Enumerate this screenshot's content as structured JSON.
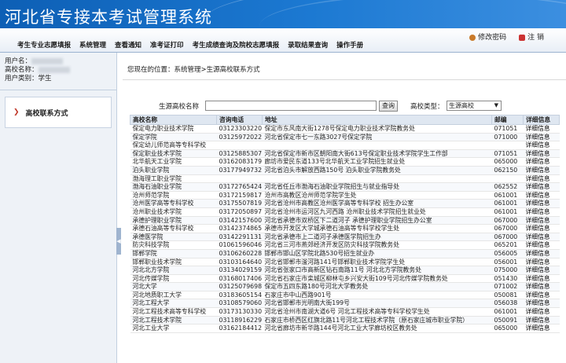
{
  "app": {
    "title": "河北省专接本考试管理系统"
  },
  "header": {
    "change_password": "修改密码",
    "logout": "注 销"
  },
  "menu": [
    "考生专业志愿填报",
    "系统管理",
    "查看通知",
    "准考证打印",
    "考生成绩查询及院校志愿填报",
    "录取结果查询",
    "操作手册"
  ],
  "sidebar": {
    "username_label": "用户名：",
    "school_label": "高校名称：",
    "usertype_label": "用户类别：",
    "usertype_value": "学生",
    "nav_item": "高校联系方式"
  },
  "breadcrumb": "您现在的位置：系统管理>生源高校联系方式",
  "filter": {
    "name_label": "生源高校名称",
    "name_value": "",
    "query_button": "查询",
    "type_label": "高校类型：",
    "type_value": "生源高校"
  },
  "table": {
    "headers": [
      "高校名称",
      "咨询电话",
      "地址",
      "邮编",
      "详细信息"
    ],
    "rows": [
      [
        "保定电力职业技术学院",
        "03123303220",
        "保定市东风南大街1278号保定电力职业技术学院教务处",
        "071051",
        "详细信息"
      ],
      [
        "保定学院",
        "03125972022",
        "河北省保定市七一东路3027号保定学院",
        "071000",
        "详细信息"
      ],
      [
        "保定幼儿师范高等专科学校",
        "",
        "",
        "",
        "详细信息"
      ],
      [
        "保定职业技术学院",
        "03125885307",
        "河北省保定市新市区朝阳南大街613号保定职业技术学院学生工作部",
        "071051",
        "详细信息"
      ],
      [
        "北华航天工业学院",
        "03162083179",
        "廊坊市爱民东道133号北华航天工业学院招生就业处",
        "065000",
        "详细信息"
      ],
      [
        "泊头职业学院",
        "03177949732",
        "河北省泊头市解放西路150号 泊头职业学院教务处",
        "062150",
        "详细信息"
      ],
      [
        "渤海理工职业学院",
        "",
        "",
        "",
        "详细信息"
      ],
      [
        "渤海石油职业学院",
        "03172765424",
        "河北省任丘市渤海石油职业学院招生与就业指导处",
        "062552",
        "详细信息"
      ],
      [
        "沧州师范学院",
        "03172159817",
        "沧州市高教区沧州师范学院学生处",
        "061001",
        "详细信息"
      ],
      [
        "沧州医学高等专科学校",
        "03175507819",
        "河北省沧州市高教区沧州医学高等专科学校 招生办公室",
        "061001",
        "详细信息"
      ],
      [
        "沧州职业技术学院",
        "03172050897",
        "河北省沧州市运河区九河西路 沧州职业技术学院招生就业处",
        "061001",
        "详细信息"
      ],
      [
        "承德护理职业学院",
        "03142157600",
        "河北省承德市双桥区下二道河子 承德护理职业学院招生办公室",
        "067000",
        "详细信息"
      ],
      [
        "承德石油高等专科学校",
        "03142374865",
        "承德市开发区大学城承德石油高等专科学校学生处",
        "067000",
        "详细信息"
      ],
      [
        "承德医学院",
        "03142291131",
        "河北省承德市上二道河子承德医学院招生办",
        "067000",
        "详细信息"
      ],
      [
        "防灾科技学院",
        "01061596046",
        "河北省三河市燕郊经济开发区防灾科技学院教务处",
        "065201",
        "详细信息"
      ],
      [
        "邯郸学院",
        "03106260228",
        "邯郸市邯山区学院北路530号招生就业办",
        "056005",
        "详细信息"
      ],
      [
        "邯郸职业技术学院",
        "03103164640",
        "河北省邯郸市滏河路141号邯郸职业技术学院学生处",
        "056001",
        "详细信息"
      ],
      [
        "河北北方学院",
        "03134029159",
        "河北省张家口市高新区钻石南路11号 河北北方学院教务处",
        "075000",
        "详细信息"
      ],
      [
        "河北传媒学院",
        "03168017406",
        "河北省石家庄市栾城区柳林屯乡兴安大街109号河北传媒学院教务处",
        "051430",
        "详细信息"
      ],
      [
        "河北大学",
        "03125079698",
        "保定市五四东路180号河北大学教务处",
        "071002",
        "详细信息"
      ],
      [
        "河北地质职工大学",
        "03183605154",
        "石家庄市中山西路901号",
        "050081",
        "详细信息"
      ],
      [
        "河北工程大学",
        "03108579060",
        "河北省邯郸市光明南大街199号",
        "056038",
        "详细信息"
      ],
      [
        "河北工程技术高等专科学校",
        "03173130330",
        "河北省沧州市南湖大道6号 河北工程技术高等专科学校学生处",
        "061001",
        "详细信息"
      ],
      [
        "河北工程技术学院",
        "03118916229",
        "石家庄市桥西区红旗北路11号河北工程技术学院（原石家庄城市职业学院）",
        "050091",
        "详细信息"
      ],
      [
        "河北工业大学",
        "03162184412",
        "河北省廊坊市新华路144号河北工业大学廊坊校区教务处",
        "065000",
        "详细信息"
      ]
    ]
  }
}
